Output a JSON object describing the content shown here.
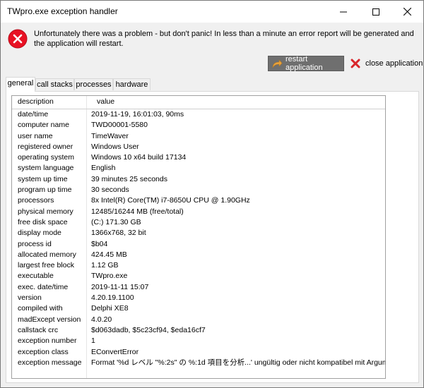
{
  "window": {
    "title": "TWpro.exe exception handler"
  },
  "message": "Unfortunately there was a problem - but don't panic! In less than a minute an error report will be generated and the application will restart.",
  "buttons": {
    "restart_label": "restart application",
    "close_label": "close application"
  },
  "tabs": [
    "general",
    "call stacks",
    "processes",
    "hardware"
  ],
  "active_tab": "general",
  "table": {
    "headers": [
      "description",
      "value"
    ],
    "rows": [
      [
        "date/time",
        "2019-11-19, 16:01:03, 90ms"
      ],
      [
        "computer name",
        "TWD00001-5580"
      ],
      [
        "user name",
        "TimeWaver"
      ],
      [
        "registered owner",
        "Windows User"
      ],
      [
        "operating system",
        "Windows 10 x64 build 17134"
      ],
      [
        "system language",
        "English"
      ],
      [
        "system up time",
        "39 minutes 25 seconds"
      ],
      [
        "program up time",
        "30 seconds"
      ],
      [
        "processors",
        "8x Intel(R) Core(TM) i7-8650U CPU @ 1.90GHz"
      ],
      [
        "physical memory",
        "12485/16244 MB (free/total)"
      ],
      [
        "free disk space",
        "(C:) 171.30 GB"
      ],
      [
        "display mode",
        "1366x768, 32 bit"
      ],
      [
        "process id",
        "$b04"
      ],
      [
        "allocated memory",
        "424.45 MB"
      ],
      [
        "largest free block",
        "1.12 GB"
      ],
      [
        "executable",
        "TWpro.exe"
      ],
      [
        "exec. date/time",
        "2019-11-11 15:07"
      ],
      [
        "version",
        "4.20.19.1100"
      ],
      [
        "compiled with",
        "Delphi XE8"
      ],
      [
        "madExcept version",
        "4.0.20"
      ],
      [
        "callstack crc",
        "$d063dadb, $5c23cf94, $eda16cf7"
      ],
      [
        "exception number",
        "1"
      ],
      [
        "exception class",
        "EConvertError"
      ],
      [
        "exception message",
        "Format '%d レベル \"%:2s\" の %:1d 項目を分析...' ungültig oder nicht kompatibel mit Argument."
      ]
    ]
  },
  "colors": {
    "restart_bg": "#6f6f6f",
    "error_red": "#e81123"
  }
}
